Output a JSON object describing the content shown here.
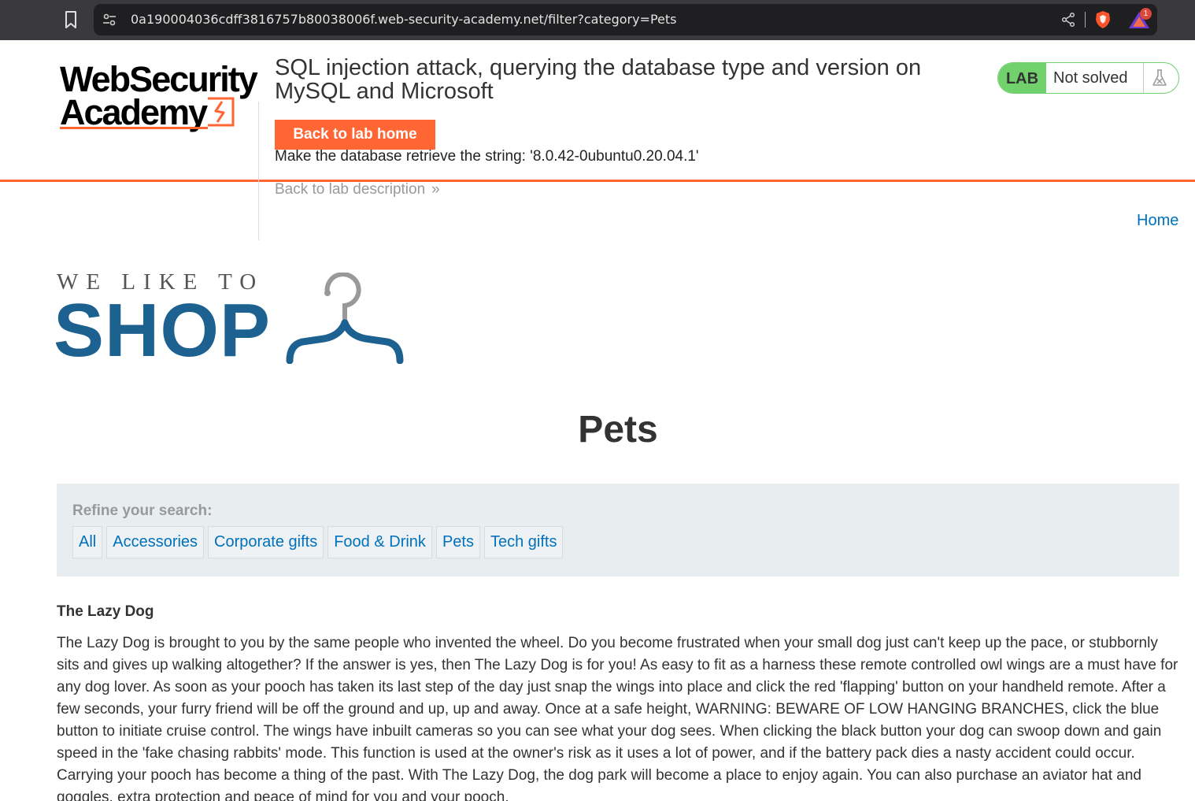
{
  "browser": {
    "url": "0a190004036cdff3816757b80038006f.web-security-academy.net/filter?category=Pets",
    "rewards_badge": "1"
  },
  "academy": {
    "logo_line1": "WebSecurity",
    "logo_line2": "Academy",
    "lab_title": "SQL injection attack, querying the database type and version on MySQL and Microsoft",
    "back_home_label": "Back to lab home",
    "lab_description": "Make the database retrieve the string: '8.0.42-0ubuntu0.20.04.1'",
    "back_description_label": "Back to lab description",
    "lab_badge": "LAB",
    "lab_status": "Not solved",
    "accent_color": "#ff6633",
    "solved_color": "#70d16d"
  },
  "shop": {
    "home_label": "Home",
    "logo_tagline": "WE LIKE TO",
    "logo_word": "SHOP",
    "category_title": "Pets",
    "filters": {
      "label": "Refine your search:",
      "items": [
        "All",
        "Accessories",
        "Corporate gifts",
        "Food & Drink",
        "Pets",
        "Tech gifts"
      ]
    },
    "product": {
      "name": "The Lazy Dog",
      "description": "The Lazy Dog is brought to you by the same people who invented the wheel. Do you become frustrated when your small dog just can't keep up the pace, or stubbornly sits and gives up walking altogether? If the answer is yes, then The Lazy Dog is for you! As easy to fit as a harness these remote controlled owl wings are a must have for any dog lover. As soon as your pooch has taken its last step of the day just snap the wings into place and click the red 'flapping' button on your handheld remote. After a few seconds, your furry friend will be off the ground and up, up and away. Once at a safe height, WARNING: BEWARE OF LOW HANGING BRANCHES, click the blue button to initiate cruise control. The wings have inbuilt cameras so you can see what your dog sees. When clicking the black button your dog can swoop down and gain speed in the 'fake chasing rabbits' mode. This function is used at the owner's risk as it uses a lot of power, and if the battery pack dies a nasty accident could occur. Carrying your pooch has become a thing of the past. With The Lazy Dog, the dog park will become a place to enjoy again. You can also purchase an aviator hat and goggles, extra protection and peace of mind for you and your pooch."
    }
  }
}
